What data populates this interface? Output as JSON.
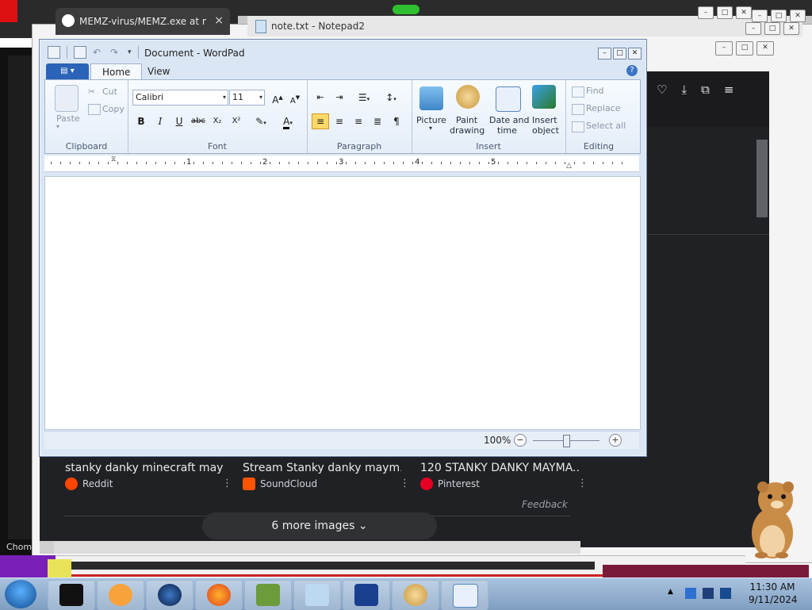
{
  "browser_tab": {
    "title": "MEMZ-virus/MEMZ.exe at mai",
    "close": "×"
  },
  "notepad_window": {
    "title": "note.txt - Notepad2"
  },
  "wordpad": {
    "title": "Document - WordPad",
    "tabs": [
      "Home",
      "View"
    ],
    "clipboard": {
      "paste": "Paste",
      "cut": "Cut",
      "copy": "Copy",
      "label": "Clipboard"
    },
    "font": {
      "family": "Calibri",
      "size": "11",
      "label": "Font",
      "buttons": {
        "bold": "B",
        "italic": "I",
        "underline": "U",
        "strike": "abc",
        "sub": "X₂",
        "sup": "X²"
      }
    },
    "paragraph": {
      "label": "Paragraph"
    },
    "insert": {
      "picture": "Picture",
      "paint_line1": "Paint",
      "paint_line2": "drawing",
      "datetime_line1": "Date and",
      "datetime_line2": "time",
      "object_line1": "Insert",
      "object_line2": "object",
      "label": "Insert"
    },
    "editing": {
      "find": "Find",
      "replace": "Replace",
      "select_all": "Select all",
      "label": "Editing"
    },
    "ruler_numbers": [
      "1",
      "2",
      "3",
      "4",
      "5"
    ],
    "zoom": "100%"
  },
  "results": [
    {
      "title": "stanky danky minecraft may ...",
      "source": "Reddit",
      "color": "#ff4500"
    },
    {
      "title": "Stream Stanky danky maym...",
      "source": "SoundCloud",
      "color": "#ff5500"
    },
    {
      "title": "120 STANKY DANKY MAYMA...",
      "source": "Pinterest",
      "color": "#e60023"
    }
  ],
  "feedback": "Feedback",
  "more_images": "6 more images",
  "background_label": "Chom",
  "taskbar": {
    "time": "11:30 AM",
    "date": "9/11/2024"
  }
}
